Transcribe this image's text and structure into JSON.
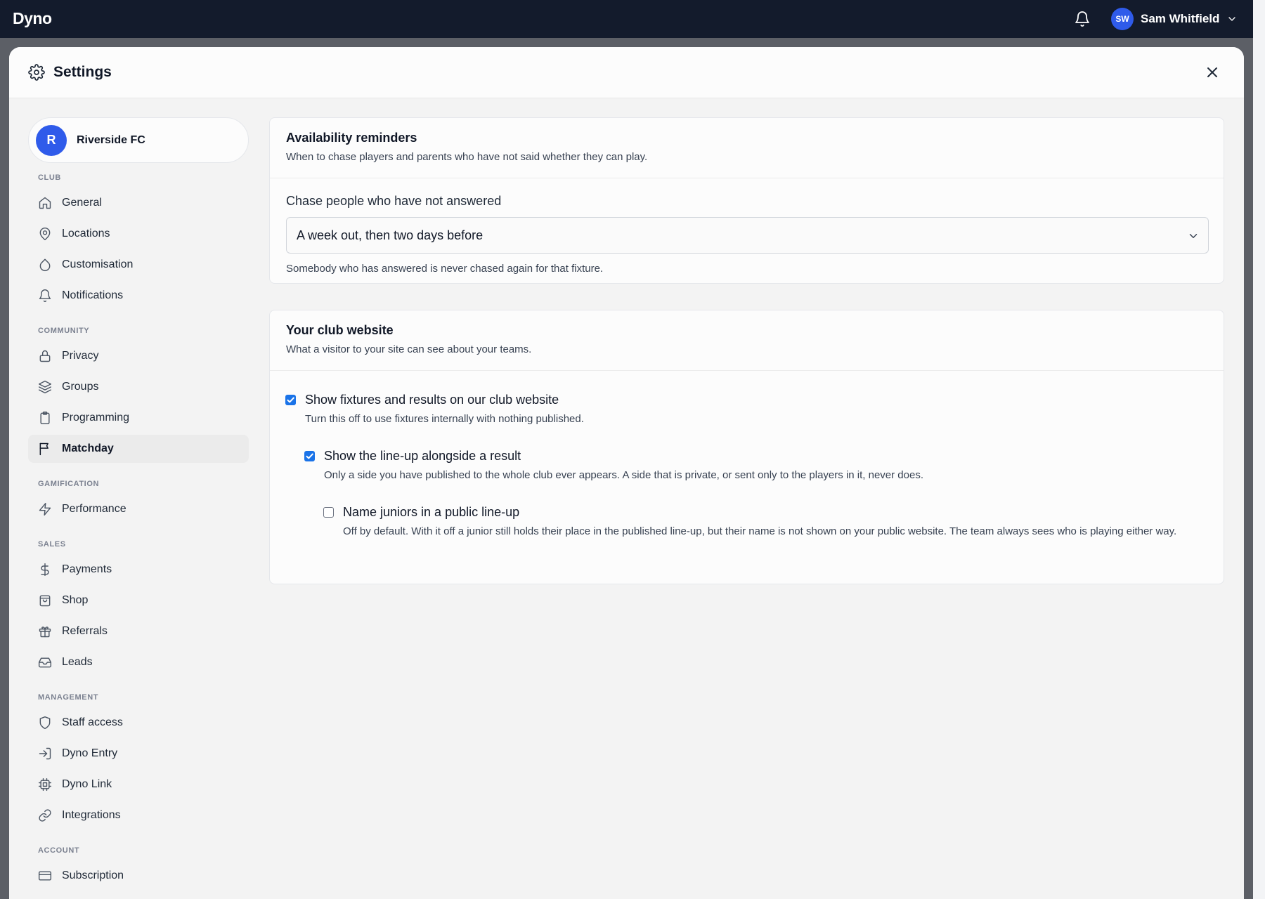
{
  "topbar": {
    "brand": "Dyno",
    "user_initials": "SW",
    "user_name": "Sam Whitfield"
  },
  "modal": {
    "title": "Settings"
  },
  "sidebar": {
    "club_initial": "R",
    "club_name": "Riverside FC",
    "sections": [
      {
        "title": "CLUB",
        "items": [
          "General",
          "Locations",
          "Customisation",
          "Notifications"
        ]
      },
      {
        "title": "COMMUNITY",
        "items": [
          "Privacy",
          "Groups",
          "Programming",
          "Matchday"
        ]
      },
      {
        "title": "GAMIFICATION",
        "items": [
          "Performance"
        ]
      },
      {
        "title": "SALES",
        "items": [
          "Payments",
          "Shop",
          "Referrals",
          "Leads"
        ]
      },
      {
        "title": "MANAGEMENT",
        "items": [
          "Staff access",
          "Dyno Entry",
          "Dyno Link",
          "Integrations"
        ]
      },
      {
        "title": "ACCOUNT",
        "items": [
          "Subscription"
        ]
      }
    ],
    "active_item": "Matchday"
  },
  "availability": {
    "title": "Availability reminders",
    "subtitle": "When to chase players and parents who have not said whether they can play.",
    "field_label": "Chase people who have not answered",
    "selected_value": "A week out, then two days before",
    "help": "Somebody who has answered is never chased again for that fixture."
  },
  "website": {
    "title": "Your club website",
    "subtitle": "What a visitor to your site can see about your teams.",
    "options": [
      {
        "label": "Show fixtures and results on our club website",
        "description": "Turn this off to use fixtures internally with nothing published.",
        "checked": true
      },
      {
        "label": "Show the line-up alongside a result",
        "description": "Only a side you have published to the whole club ever appears. A side that is private, or sent only to the players in it, never does.",
        "checked": true
      },
      {
        "label": "Name juniors in a public line-up",
        "description": "Off by default. With it off a junior still holds their place in the published line-up, but their name is not shown on your public website. The team always sees who is playing either way.",
        "checked": false
      }
    ]
  },
  "colors": {
    "topbar": "#131b2c",
    "accent": "#2f5bea",
    "checkbox": "#1a73e8"
  }
}
